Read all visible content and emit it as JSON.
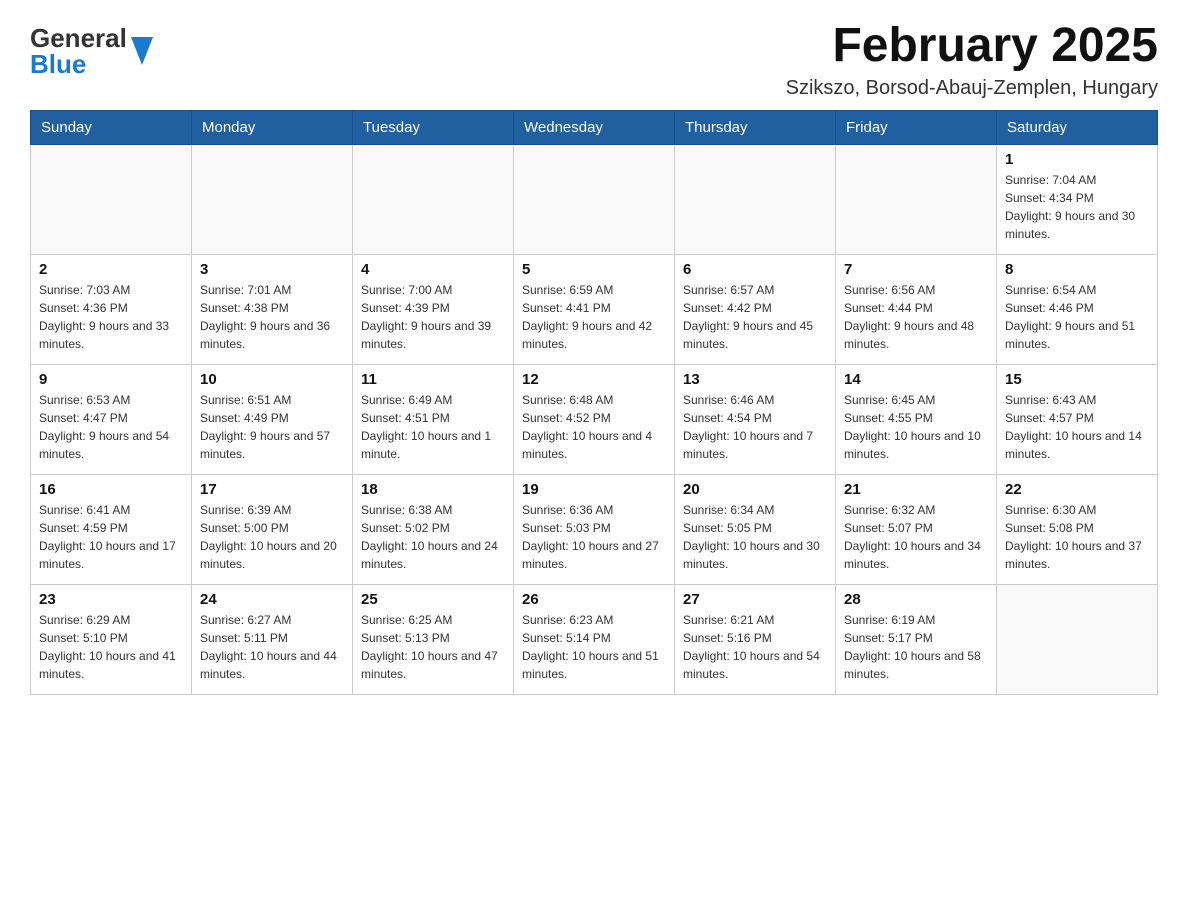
{
  "logo": {
    "line1": "General",
    "line2": "Blue"
  },
  "header": {
    "title": "February 2025",
    "subtitle": "Szikszo, Borsod-Abauj-Zemplen, Hungary"
  },
  "days_of_week": [
    "Sunday",
    "Monday",
    "Tuesday",
    "Wednesday",
    "Thursday",
    "Friday",
    "Saturday"
  ],
  "weeks": [
    [
      {
        "day": "",
        "info": ""
      },
      {
        "day": "",
        "info": ""
      },
      {
        "day": "",
        "info": ""
      },
      {
        "day": "",
        "info": ""
      },
      {
        "day": "",
        "info": ""
      },
      {
        "day": "",
        "info": ""
      },
      {
        "day": "1",
        "info": "Sunrise: 7:04 AM\nSunset: 4:34 PM\nDaylight: 9 hours and 30 minutes."
      }
    ],
    [
      {
        "day": "2",
        "info": "Sunrise: 7:03 AM\nSunset: 4:36 PM\nDaylight: 9 hours and 33 minutes."
      },
      {
        "day": "3",
        "info": "Sunrise: 7:01 AM\nSunset: 4:38 PM\nDaylight: 9 hours and 36 minutes."
      },
      {
        "day": "4",
        "info": "Sunrise: 7:00 AM\nSunset: 4:39 PM\nDaylight: 9 hours and 39 minutes."
      },
      {
        "day": "5",
        "info": "Sunrise: 6:59 AM\nSunset: 4:41 PM\nDaylight: 9 hours and 42 minutes."
      },
      {
        "day": "6",
        "info": "Sunrise: 6:57 AM\nSunset: 4:42 PM\nDaylight: 9 hours and 45 minutes."
      },
      {
        "day": "7",
        "info": "Sunrise: 6:56 AM\nSunset: 4:44 PM\nDaylight: 9 hours and 48 minutes."
      },
      {
        "day": "8",
        "info": "Sunrise: 6:54 AM\nSunset: 4:46 PM\nDaylight: 9 hours and 51 minutes."
      }
    ],
    [
      {
        "day": "9",
        "info": "Sunrise: 6:53 AM\nSunset: 4:47 PM\nDaylight: 9 hours and 54 minutes."
      },
      {
        "day": "10",
        "info": "Sunrise: 6:51 AM\nSunset: 4:49 PM\nDaylight: 9 hours and 57 minutes."
      },
      {
        "day": "11",
        "info": "Sunrise: 6:49 AM\nSunset: 4:51 PM\nDaylight: 10 hours and 1 minute."
      },
      {
        "day": "12",
        "info": "Sunrise: 6:48 AM\nSunset: 4:52 PM\nDaylight: 10 hours and 4 minutes."
      },
      {
        "day": "13",
        "info": "Sunrise: 6:46 AM\nSunset: 4:54 PM\nDaylight: 10 hours and 7 minutes."
      },
      {
        "day": "14",
        "info": "Sunrise: 6:45 AM\nSunset: 4:55 PM\nDaylight: 10 hours and 10 minutes."
      },
      {
        "day": "15",
        "info": "Sunrise: 6:43 AM\nSunset: 4:57 PM\nDaylight: 10 hours and 14 minutes."
      }
    ],
    [
      {
        "day": "16",
        "info": "Sunrise: 6:41 AM\nSunset: 4:59 PM\nDaylight: 10 hours and 17 minutes."
      },
      {
        "day": "17",
        "info": "Sunrise: 6:39 AM\nSunset: 5:00 PM\nDaylight: 10 hours and 20 minutes."
      },
      {
        "day": "18",
        "info": "Sunrise: 6:38 AM\nSunset: 5:02 PM\nDaylight: 10 hours and 24 minutes."
      },
      {
        "day": "19",
        "info": "Sunrise: 6:36 AM\nSunset: 5:03 PM\nDaylight: 10 hours and 27 minutes."
      },
      {
        "day": "20",
        "info": "Sunrise: 6:34 AM\nSunset: 5:05 PM\nDaylight: 10 hours and 30 minutes."
      },
      {
        "day": "21",
        "info": "Sunrise: 6:32 AM\nSunset: 5:07 PM\nDaylight: 10 hours and 34 minutes."
      },
      {
        "day": "22",
        "info": "Sunrise: 6:30 AM\nSunset: 5:08 PM\nDaylight: 10 hours and 37 minutes."
      }
    ],
    [
      {
        "day": "23",
        "info": "Sunrise: 6:29 AM\nSunset: 5:10 PM\nDaylight: 10 hours and 41 minutes."
      },
      {
        "day": "24",
        "info": "Sunrise: 6:27 AM\nSunset: 5:11 PM\nDaylight: 10 hours and 44 minutes."
      },
      {
        "day": "25",
        "info": "Sunrise: 6:25 AM\nSunset: 5:13 PM\nDaylight: 10 hours and 47 minutes."
      },
      {
        "day": "26",
        "info": "Sunrise: 6:23 AM\nSunset: 5:14 PM\nDaylight: 10 hours and 51 minutes."
      },
      {
        "day": "27",
        "info": "Sunrise: 6:21 AM\nSunset: 5:16 PM\nDaylight: 10 hours and 54 minutes."
      },
      {
        "day": "28",
        "info": "Sunrise: 6:19 AM\nSunset: 5:17 PM\nDaylight: 10 hours and 58 minutes."
      },
      {
        "day": "",
        "info": ""
      }
    ]
  ]
}
